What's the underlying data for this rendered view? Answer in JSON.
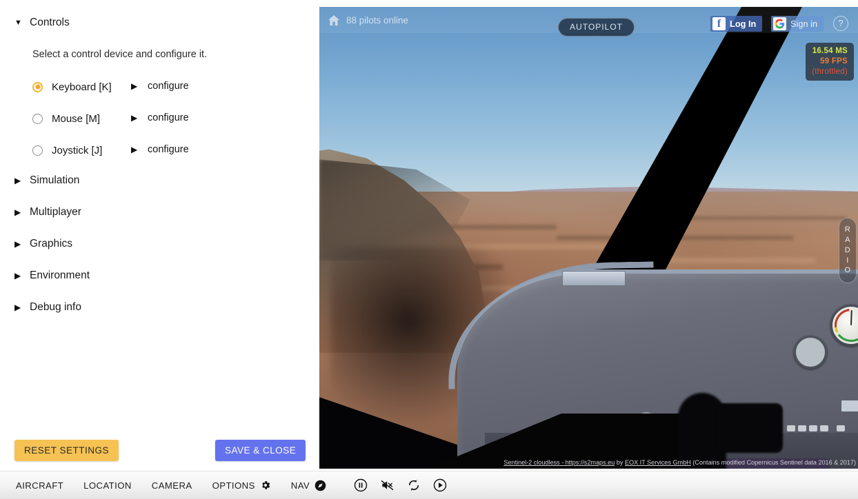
{
  "settings": {
    "sections": [
      {
        "id": "controls",
        "label": "Controls",
        "expanded": true,
        "caret": "▼"
      },
      {
        "id": "simulation",
        "label": "Simulation",
        "expanded": false,
        "caret": "▶"
      },
      {
        "id": "multiplayer",
        "label": "Multiplayer",
        "expanded": false,
        "caret": "▶"
      },
      {
        "id": "graphics",
        "label": "Graphics",
        "expanded": false,
        "caret": "▶"
      },
      {
        "id": "environment",
        "label": "Environment",
        "expanded": false,
        "caret": "▶"
      },
      {
        "id": "debug",
        "label": "Debug info",
        "expanded": false,
        "caret": "▶"
      }
    ],
    "controls": {
      "hint": "Select a control device and configure it.",
      "devices": [
        {
          "label": "Keyboard [K]",
          "selected": true,
          "configure": "configure",
          "caret": "▶"
        },
        {
          "label": "Mouse [M]",
          "selected": false,
          "configure": "configure",
          "caret": "▶"
        },
        {
          "label": "Joystick [J]",
          "selected": false,
          "configure": "configure",
          "caret": "▶"
        }
      ]
    },
    "buttons": {
      "reset": "RESET SETTINGS",
      "save": "SAVE & CLOSE"
    },
    "colors": {
      "reset_bg": "#f5c253",
      "save_bg": "#6472ee",
      "radio_selected": "#f5a623"
    }
  },
  "toolbar": {
    "items": [
      {
        "id": "aircraft",
        "label": "AIRCRAFT",
        "icon": null
      },
      {
        "id": "location",
        "label": "LOCATION",
        "icon": null
      },
      {
        "id": "camera",
        "label": "CAMERA",
        "icon": null
      },
      {
        "id": "options",
        "label": "OPTIONS",
        "icon": "gear-icon"
      },
      {
        "id": "nav",
        "label": "NAV",
        "icon": "compass-icon"
      }
    ],
    "media": [
      {
        "id": "pause",
        "icon": "pause-icon"
      },
      {
        "id": "mute",
        "icon": "speaker-muted-icon"
      },
      {
        "id": "reload",
        "icon": "refresh-icon"
      },
      {
        "id": "play",
        "icon": "play-icon"
      }
    ]
  },
  "sim": {
    "pilots_online": "88 pilots online",
    "home_icon": "home-icon",
    "autopilot": "AUTOPILOT",
    "facebook_login": "Log In",
    "google_signin": "Sign in",
    "help": "?",
    "radio_tab": [
      "R",
      "A",
      "D",
      "I",
      "O"
    ],
    "perf": {
      "ms": "16.54 MS",
      "fps": "59 FPS",
      "state": "(throttled)",
      "ms_color": "#d8e84a",
      "fps_color": "#ef7b2e",
      "state_color": "#e2533a"
    },
    "attribution": {
      "link1": "Sentinel-2 cloudless - https://s2maps.eu",
      "mid": " by ",
      "link2": "EOX IT Services GmbH",
      "tail": " (Contains modified Copernicus Sentinel data 2016 & 2017)"
    }
  }
}
